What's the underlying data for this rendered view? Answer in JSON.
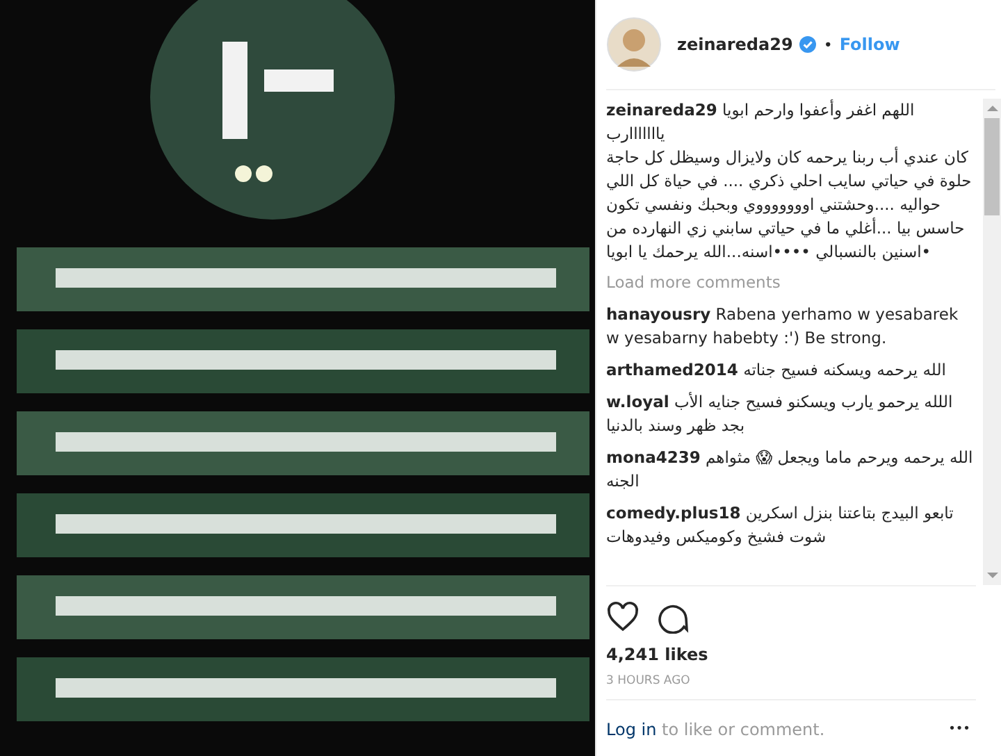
{
  "header": {
    "username": "zeinareda29",
    "verified": true,
    "separator": "•",
    "follow": "Follow"
  },
  "caption": "**zeinareda29** اللهم اغفر وأعفوا وارحم ابويا يااااااارب\nكان عندي أب ربنا يرحمه كان ولايزال وسيظل كل حاجة حلوة في حياتي سايب احلي ذكري .... في حياة كل اللي حواليه ....وحشتني اوووووووي وبحبك ونفسي تكون حاسس بيا ...أغلي ما في حياتي سابني زي النهارده من •اسنين بالنسبالي ••••اسنه...الله يرحمك يا ابويا",
  "load_more": "Load more comments",
  "comments": [
    {
      "text": "**hanayousry** Rabena yerhamo w yesabarek w yesabarny habebty :') Be strong."
    },
    {
      "text": "**arthamed2014** الله يرحمه ويسكنه فسيح جناته"
    },
    {
      "text": "**w.loyal** اللله يرحمو يارب ويسكنو فسيح جنايه الأب بجد ظهر وسند بالدنيا"
    },
    {
      "text": "**mona4239** الله يرحمه ويرحم ماما ويجعل 😱 مثواهم الجنه"
    },
    {
      "text": "**comedy.plus18** تابعو البيدج بتاعتنا بنزل اسكرين شوت فشيخ وكوميكس وفيدوهات"
    }
  ],
  "likes": "4,241 likes",
  "time": "3 HOURS AGO",
  "login": {
    "link": "Log in",
    "text": "to like or comment."
  },
  "more": "•••"
}
